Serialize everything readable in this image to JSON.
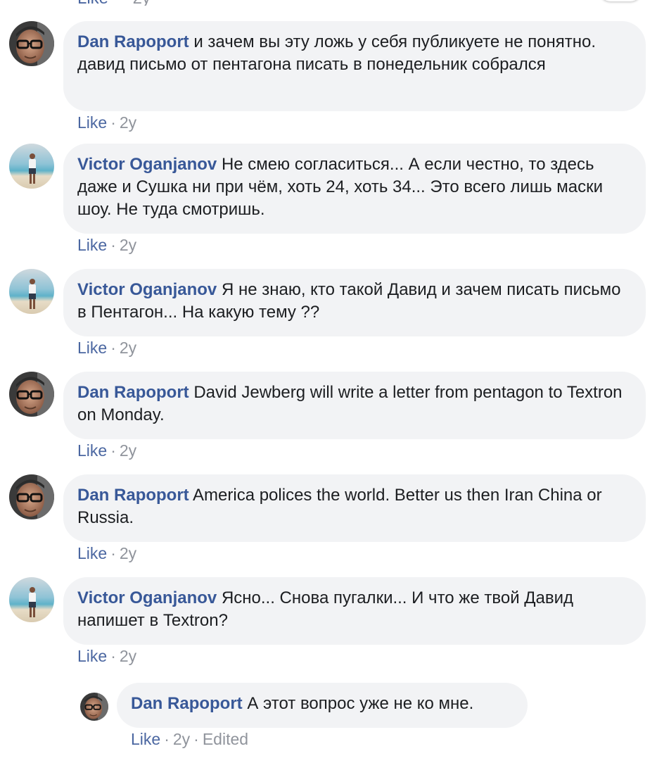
{
  "comments": [
    {
      "author": "Dan Rapoport",
      "text": "и зачем вы эту ложь у себя публикуете не понятно. давид письмо от пентагона писать в понедельник собрался",
      "like_label": "Like",
      "time": "2y",
      "avatar_icon": "man-with-glasses-avatar"
    },
    {
      "author": "Victor Oganjanov",
      "text": "Не смею согласиться... А если честно, то здесь даже и Сушка ни при чём, хоть 24, хоть 34... Это всего лишь маски шоу. Не туда смотришь.",
      "like_label": "Like",
      "time": "2y",
      "avatar_icon": "man-on-beach-avatar"
    },
    {
      "author": "Victor Oganjanov",
      "text": "Я не знаю, кто такой Давид и зачем писать письмо в Пентагон... На какую тему ??",
      "like_label": "Like",
      "time": "2y",
      "avatar_icon": "man-on-beach-avatar"
    },
    {
      "author": "Dan Rapoport",
      "text": "David Jewberg will write a letter from pentagon to Textron on Monday.",
      "like_label": "Like",
      "time": "2y",
      "avatar_icon": "man-with-glasses-avatar"
    },
    {
      "author": "Dan Rapoport",
      "text": "America polices the world. Better us then Iran China or Russia.",
      "like_label": "Like",
      "time": "2y",
      "avatar_icon": "man-with-glasses-avatar"
    },
    {
      "author": "Victor Oganjanov",
      "text": "Ясно... Снова пугалки... И что же твой Давид напишет в Textron?",
      "like_label": "Like",
      "time": "2y",
      "avatar_icon": "man-on-beach-avatar"
    }
  ],
  "reply": {
    "author": "Dan Rapoport",
    "text": "А этот вопрос уже не ко мне.",
    "like_label": "Like",
    "time": "2y",
    "edited_label": "Edited",
    "avatar_icon": "man-with-glasses-avatar"
  },
  "colors": {
    "author": "#385898",
    "like": "#4b67a1",
    "meta": "#90949c",
    "bubble": "#f2f3f5"
  }
}
